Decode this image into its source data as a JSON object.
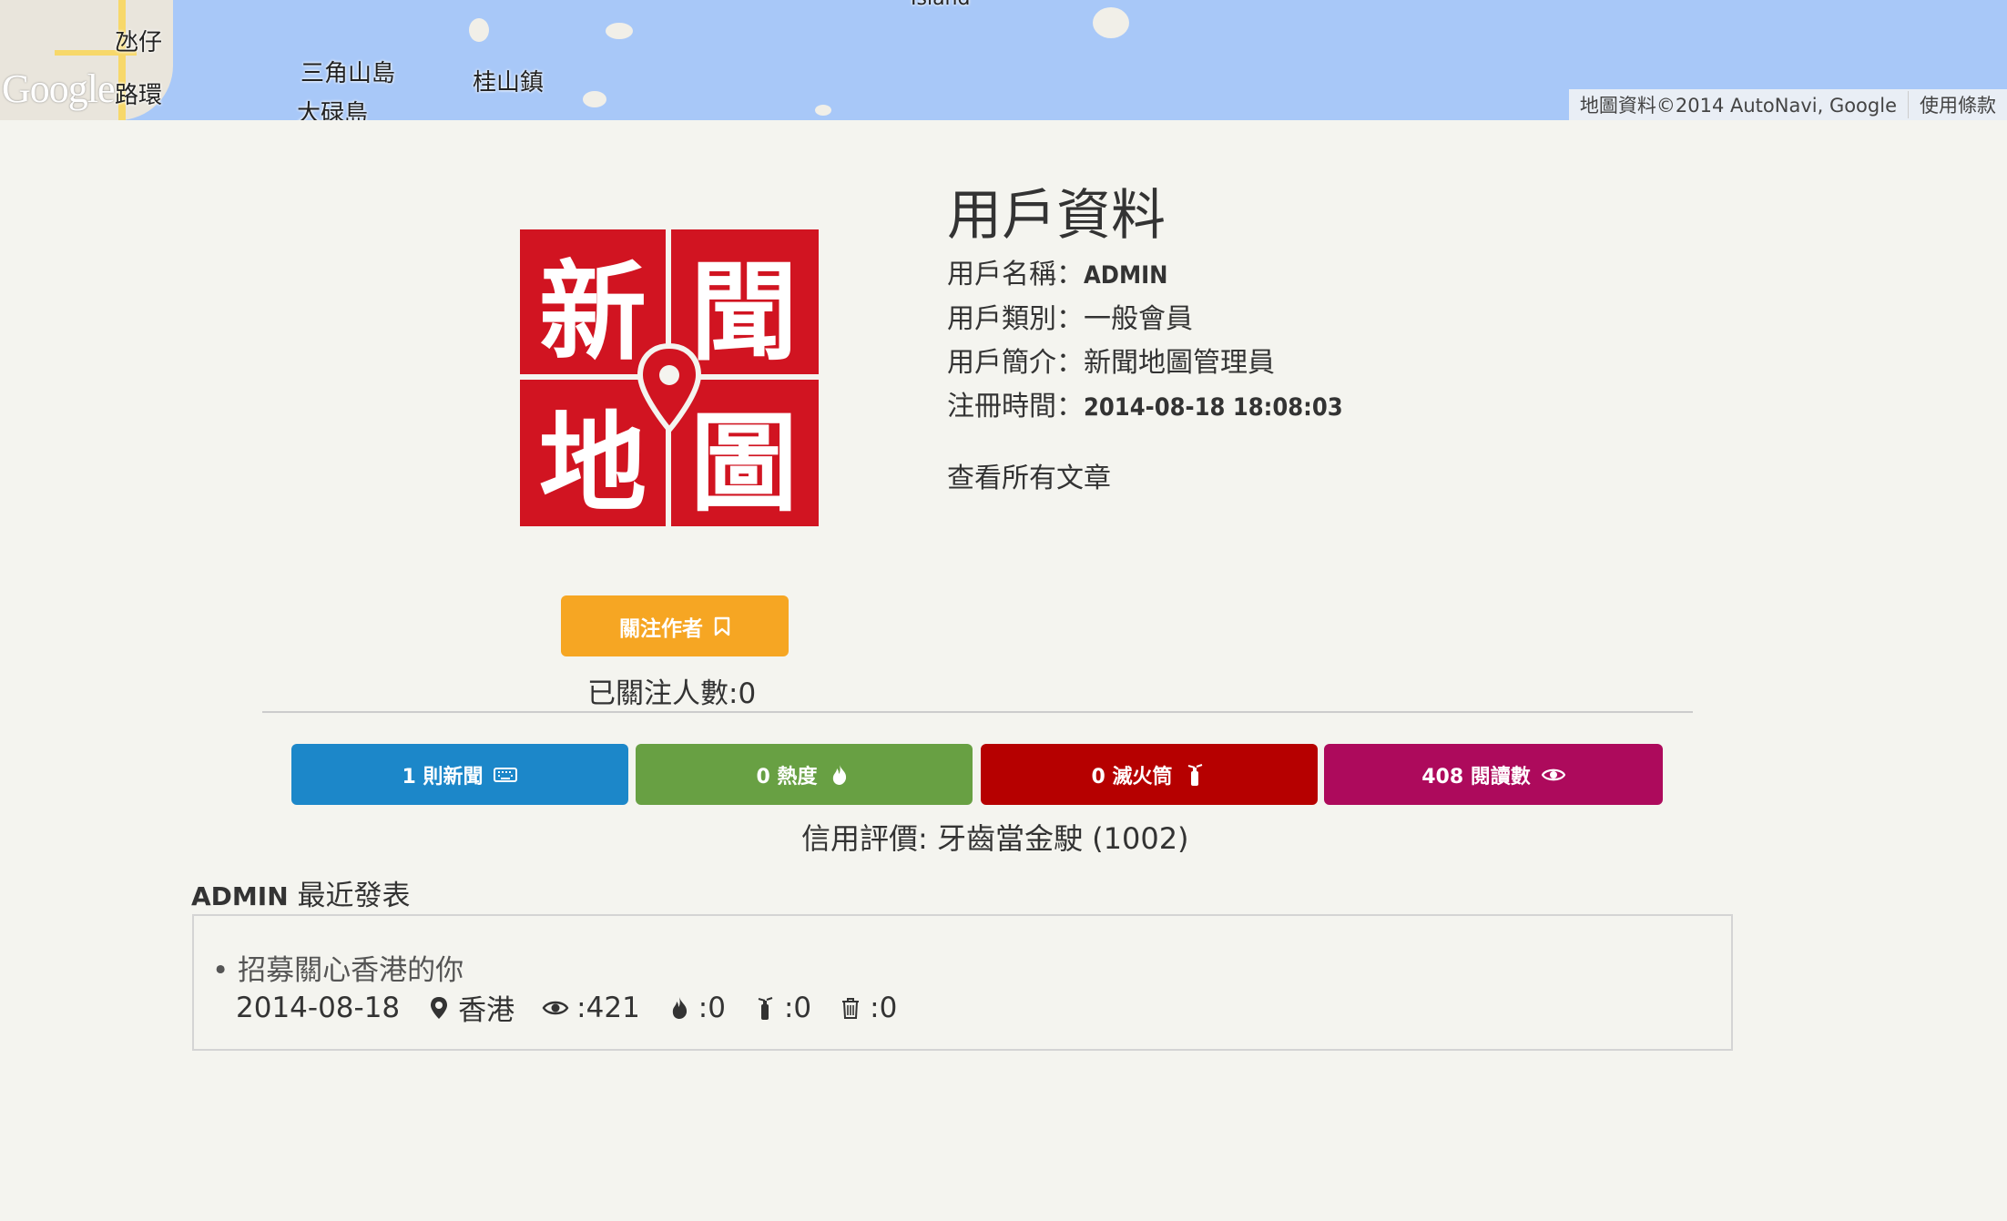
{
  "map": {
    "labels": [
      "氹仔",
      "路環",
      "三角山島",
      "大碌島",
      "桂山鎮",
      "Island"
    ],
    "logo": "Google",
    "attribution": "地圖資料©2014 AutoNavi, Google",
    "terms": "使用條款"
  },
  "site_logo": {
    "chars": [
      "新",
      "聞",
      "地",
      "圖"
    ]
  },
  "profile": {
    "title": "用戶資料",
    "username_label": "用戶名稱：",
    "username": "ADMIN",
    "type_label": "用戶類別：",
    "type": "一般會員",
    "bio_label": "用戶簡介：",
    "bio": "新聞地圖管理員",
    "registered_label": "注冊時間：",
    "registered": "2014-08-18 18:08:03",
    "view_all": "查看所有文章"
  },
  "follow": {
    "button_label": "關注作者",
    "followers_text": "已關注人數:0"
  },
  "stats": [
    {
      "label": "1 則新聞",
      "icon": "keyboard-icon",
      "color": "#1c87c9"
    },
    {
      "label": "0 熱度",
      "icon": "fire-icon",
      "color": "#68a043"
    },
    {
      "label": "0 滅火筒",
      "icon": "extinguisher-icon",
      "color": "#b60000"
    },
    {
      "label": "408 閱讀數",
      "icon": "eye-icon",
      "color": "#ad0a5c"
    }
  ],
  "credit": "信用評價: 牙齒當金駛 (1002)",
  "recent": {
    "author": "ADMIN",
    "title_suffix": " 最近發表",
    "posts": [
      {
        "title": "招募關心香港的你",
        "date": "2014-08-18",
        "location": "香港",
        "views": ":421",
        "hot": ":0",
        "extinguish": ":0",
        "trash": ":0"
      }
    ]
  }
}
